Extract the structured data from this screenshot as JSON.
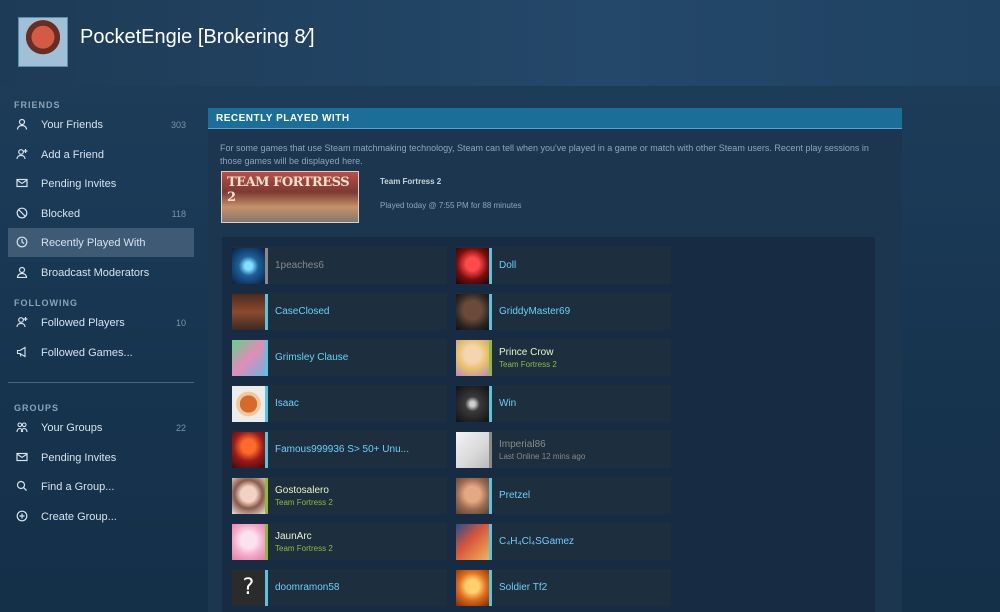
{
  "profile": {
    "name": "PocketEngie [Brokering 8⁄]"
  },
  "sidebar": {
    "friends_title": "FRIENDS",
    "following_title": "FOLLOWING",
    "groups_title": "GROUPS",
    "friends_items": [
      {
        "label": "Your Friends",
        "count": "303",
        "icon": "person-icon"
      },
      {
        "label": "Add a Friend",
        "count": "",
        "icon": "add-person-icon"
      },
      {
        "label": "Pending Invites",
        "count": "",
        "icon": "envelope-icon"
      },
      {
        "label": "Blocked",
        "count": "118",
        "icon": "blocked-icon"
      },
      {
        "label": "Recently Played With",
        "count": "",
        "icon": "clock-icon"
      },
      {
        "label": "Broadcast Moderators",
        "count": "",
        "icon": "moderator-icon"
      }
    ],
    "following_items": [
      {
        "label": "Followed Players",
        "count": "10",
        "icon": "followed-players-icon"
      },
      {
        "label": "Followed Games...",
        "count": "",
        "icon": "megaphone-icon"
      }
    ],
    "groups_items": [
      {
        "label": "Your Groups",
        "count": "22",
        "icon": "group-icon"
      },
      {
        "label": "Pending Invites",
        "count": "",
        "icon": "envelope-icon"
      },
      {
        "label": "Find a Group...",
        "count": "",
        "icon": "search-icon"
      },
      {
        "label": "Create Group...",
        "count": "",
        "icon": "plus-circle-icon"
      }
    ]
  },
  "panel": {
    "header": "RECENTLY PLAYED WITH",
    "description": "For some games that use Steam matchmaking technology, Steam can tell when you've played in a game or match with other Steam users. Recent play sessions in those games will be displayed here.",
    "game": {
      "banner_text": "TEAM FORTRESS 2",
      "name": "Team Fortress 2",
      "played": "Played today @ 7:55 PM for 88 minutes"
    }
  },
  "friends": [
    {
      "name": "1peaches6",
      "status": "",
      "state": "offline"
    },
    {
      "name": "Doll",
      "status": "",
      "state": "online"
    },
    {
      "name": "CaseClosed",
      "status": "",
      "state": "online"
    },
    {
      "name": "GriddyMaster69",
      "status": "",
      "state": "online"
    },
    {
      "name": "Grimsley Clause",
      "status": "",
      "state": "online"
    },
    {
      "name": "Prince Crow",
      "status": "Team Fortress 2",
      "state": "ingame"
    },
    {
      "name": "Isaac",
      "status": "",
      "state": "online"
    },
    {
      "name": "Win",
      "status": "",
      "state": "online"
    },
    {
      "name": "Famous999936 S> 50+ Unu...",
      "status": "",
      "state": "online"
    },
    {
      "name": "Imperial86",
      "status": "Last Online 12 mins ago",
      "state": "offline"
    },
    {
      "name": "Gostosalero",
      "status": "Team Fortress 2",
      "state": "ingame"
    },
    {
      "name": "Pretzel",
      "status": "",
      "state": "online"
    },
    {
      "name": "JaunArc",
      "status": "Team Fortress 2",
      "state": "ingame"
    },
    {
      "name": "C₄H₄Cl₄SGamez",
      "status": "",
      "state": "online"
    },
    {
      "name": "doomramon58",
      "status": "",
      "state": "online"
    },
    {
      "name": "Soldier Tf2",
      "status": "",
      "state": "online"
    }
  ],
  "colors": {
    "accent_header": "#1a6e98",
    "online_blue": "#57c4e2",
    "ingame_green": "#90ba3c",
    "offline_gray": "#8a8a8a"
  }
}
